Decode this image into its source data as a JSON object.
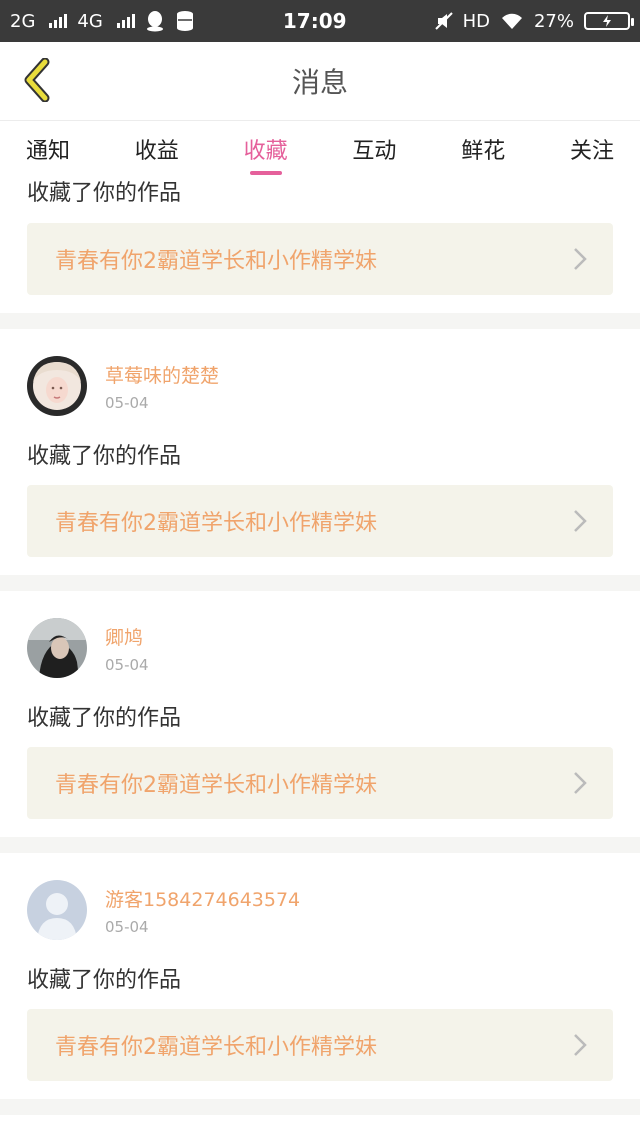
{
  "status_bar": {
    "network_1": "2G",
    "network_2": "4G",
    "time": "17:09",
    "hd": "HD",
    "battery_percent": "27%"
  },
  "header": {
    "title": "消息"
  },
  "tabs": [
    {
      "label": "通知",
      "active": false
    },
    {
      "label": "收益",
      "active": false
    },
    {
      "label": "收藏",
      "active": true
    },
    {
      "label": "互动",
      "active": false
    },
    {
      "label": "鲜花",
      "active": false
    },
    {
      "label": "关注",
      "active": false
    }
  ],
  "items": [
    {
      "action": "收藏了你的作品",
      "work_title": "青春有你2霸道学长和小作精学妹"
    },
    {
      "user": "草莓味的楚楚",
      "date": "05-04",
      "action": "收藏了你的作品",
      "work_title": "青春有你2霸道学长和小作精学妹"
    },
    {
      "user": "卿鸠",
      "date": "05-04",
      "action": "收藏了你的作品",
      "work_title": "青春有你2霸道学长和小作精学妹"
    },
    {
      "user": "游客1584274643574",
      "date": "05-04",
      "action": "收藏了你的作品",
      "work_title": "青春有你2霸道学长和小作精学妹"
    }
  ],
  "colors": {
    "accent": "#e5609b",
    "username": "#f0a46c",
    "work_card_bg": "#f4f3ea",
    "back_icon": "#e8dc3c"
  }
}
